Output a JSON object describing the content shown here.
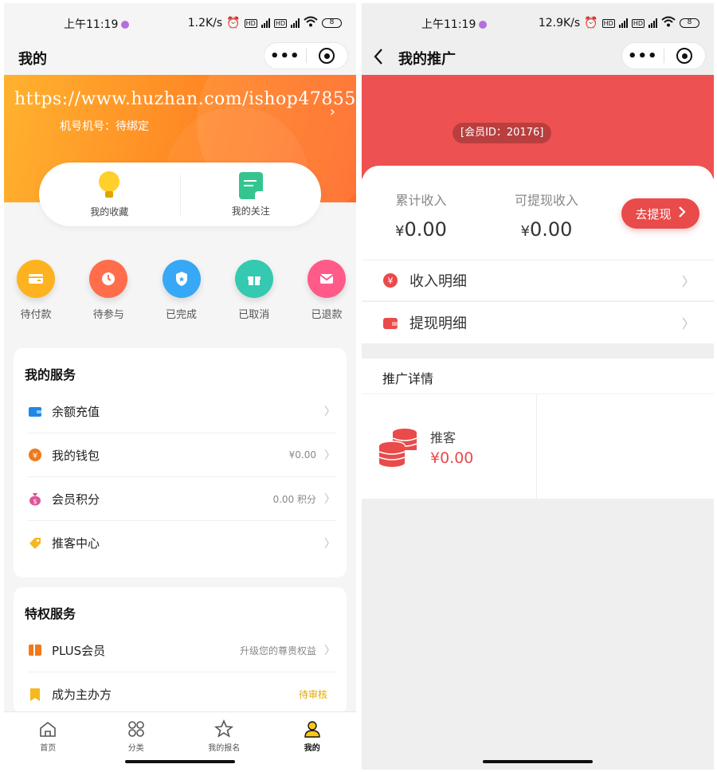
{
  "left": {
    "status": {
      "time": "上午11:19",
      "speed": "1.2K/s",
      "battery": "8"
    },
    "title": "我的",
    "watermark": "https://www.huzhan.com/ishop47855",
    "bind_phone": "机号机号：待绑定",
    "fav": {
      "collect": "我的收藏",
      "follow": "我的关注"
    },
    "orders": [
      {
        "label": "待付款",
        "icon": "card-icon",
        "color": "#ffb21f"
      },
      {
        "label": "待参与",
        "icon": "clock-icon",
        "color": "#ff6d4a"
      },
      {
        "label": "已完成",
        "icon": "shield-icon",
        "color": "#37a8f5"
      },
      {
        "label": "已取消",
        "icon": "gift-icon",
        "color": "#34c9b0"
      },
      {
        "label": "已退款",
        "icon": "mail-icon",
        "color": "#ff5a8a"
      }
    ],
    "services": {
      "title": "我的服务",
      "items": [
        {
          "label": "余额充值",
          "value": "",
          "icon": "wallet-icon"
        },
        {
          "label": "我的钱包",
          "value": "¥0.00",
          "icon": "coin-icon"
        },
        {
          "label": "会员积分",
          "value": "0.00 积分",
          "icon": "money-bag-icon"
        },
        {
          "label": "推客中心",
          "value": "",
          "icon": "tag-icon"
        }
      ]
    },
    "privileges": {
      "title": "特权服务",
      "items": [
        {
          "label": "PLUS会员",
          "value": "升级您的尊贵权益",
          "icon": "plus-card-icon"
        },
        {
          "label": "成为主办方",
          "value": "待审核",
          "icon": "bookmark-icon"
        }
      ]
    },
    "tabs": [
      {
        "label": "首页",
        "icon": "home-icon"
      },
      {
        "label": "分类",
        "icon": "grid-icon"
      },
      {
        "label": "我的报名",
        "icon": "star-icon"
      },
      {
        "label": "我的",
        "icon": "user-icon",
        "active": true
      }
    ]
  },
  "right": {
    "status": {
      "time": "上午11:19",
      "speed": "12.9K/s",
      "battery": "8"
    },
    "title": "我的推广",
    "member_id": "[会员ID：20176]",
    "total_income": {
      "label": "累计收入",
      "currency": "¥",
      "amount": "0.00"
    },
    "withdrawable": {
      "label": "可提现收入",
      "currency": "¥",
      "amount": "0.00"
    },
    "withdraw_button": "去提现",
    "rows": {
      "income_detail": "收入明细",
      "withdraw_detail": "提现明细"
    },
    "promo": {
      "title": "推广详情",
      "customer_label": "推客",
      "customer_amount": "¥0.00"
    }
  },
  "colors": {
    "orange": "#ff8a25",
    "red": "#ee5151",
    "accent_red": "#e94a4a"
  }
}
